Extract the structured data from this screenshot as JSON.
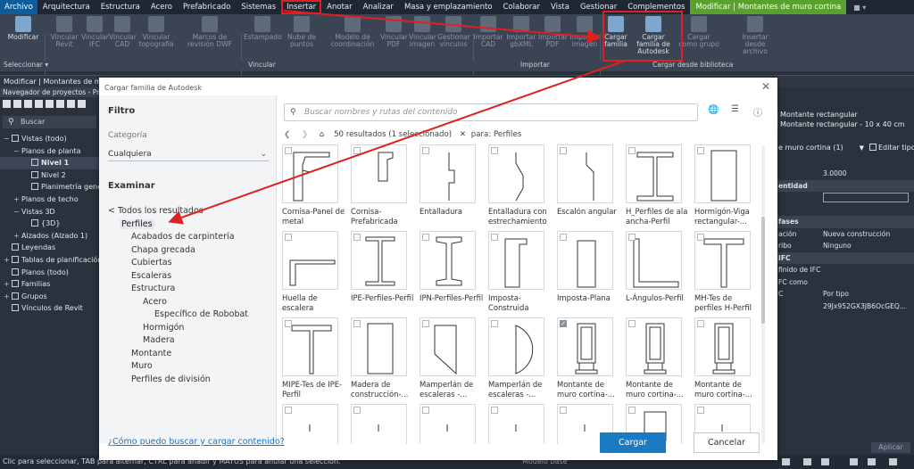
{
  "menu": [
    "Archivo",
    "Arquitectura",
    "Estructura",
    "Acero",
    "Prefabricado",
    "Sistemas",
    "Insertar",
    "Anotar",
    "Analizar",
    "Masa y emplazamiento",
    "Colaborar",
    "Vista",
    "Gestionar",
    "Complementos",
    "Modificar | Montantes de muro cortina"
  ],
  "ribbon": {
    "buttons": [
      "Modificar",
      "Vincular Revit",
      "Vincular IFC",
      "Vincular CAD",
      "Vincular topografía",
      "Marcos de revisión DWF",
      "Estampado",
      "Nube de puntos",
      "Modelo de coordinación",
      "Vincular PDF",
      "Vincular imagen",
      "Gestionar vínculos",
      "Importar CAD",
      "Importar gbXML",
      "Importar PDF",
      "Importar imagen",
      "Cargar familia",
      "Cargar familia de Autodesk",
      "Cargar como grupo",
      "Insertar desde archivo"
    ],
    "panels": [
      "Seleccionar",
      "Vincular",
      "Importar",
      "Cargar desde biblioteca"
    ]
  },
  "context_bar": "Modificar | Montantes de muro",
  "browser": {
    "title": "Navegador de proyectos - Proy",
    "search_placeholder": "Buscar",
    "tree": [
      {
        "t": "−",
        "label": "Vistas (todo)",
        "lvl": 0
      },
      {
        "t": "−",
        "label": "Planos de planta",
        "lvl": 1
      },
      {
        "t": "",
        "label": "Nivel 1",
        "lvl": 2,
        "sel": true
      },
      {
        "t": "",
        "label": "Nivel 2",
        "lvl": 2
      },
      {
        "t": "",
        "label": "Planimetría gener",
        "lvl": 2
      },
      {
        "t": "+",
        "label": "Planos de techo",
        "lvl": 1
      },
      {
        "t": "−",
        "label": "Vistas 3D",
        "lvl": 1
      },
      {
        "t": "",
        "label": "{3D}",
        "lvl": 2
      },
      {
        "t": "+",
        "label": "Alzados (Alzado 1)",
        "lvl": 1
      },
      {
        "t": "",
        "label": "Leyendas",
        "lvl": 0
      },
      {
        "t": "+",
        "label": "Tablas de planificación/c",
        "lvl": 0
      },
      {
        "t": "",
        "label": "Planos (todo)",
        "lvl": 0
      },
      {
        "t": "+",
        "label": "Familias",
        "lvl": 0
      },
      {
        "t": "+",
        "label": "Grupos",
        "lvl": 0
      },
      {
        "t": "",
        "label": "Vínculos de Revit",
        "lvl": 0
      }
    ]
  },
  "properties": {
    "type_name": "Montante rectangular",
    "type_sub": "Montante rectangular - 10 x 40 cm",
    "selector": "e muro cortina (1)",
    "edit_type": "Editar tipo",
    "rows": [
      {
        "k": "",
        "v": "3.0000",
        "hd": false
      },
      {
        "k": "entidad",
        "v": "",
        "hd": true
      },
      {
        "k": "",
        "v": "",
        "hd": false
      },
      {
        "k": "",
        "v": "",
        "hd": false
      },
      {
        "k": "fases",
        "v": "",
        "hd": true
      },
      {
        "k": "ación",
        "v": "Nueva construcción",
        "hd": false
      },
      {
        "k": "ribo",
        "v": "Ninguno",
        "hd": false
      },
      {
        "k": "IFC",
        "v": "",
        "hd": true
      },
      {
        "k": "finido de IFC",
        "v": "",
        "hd": false
      },
      {
        "k": "FC como",
        "v": "",
        "hd": false
      },
      {
        "k": "C",
        "v": "Por tipo",
        "hd": false
      },
      {
        "k": "",
        "v": "29Jx952GX3JB6OcGEQ...",
        "hd": false
      }
    ],
    "apply": "Aplicar"
  },
  "statusbar": {
    "text": "Clic para seleccionar, TAB para alternar, CTRL para añadir y MAYÚS para anular una selección.",
    "model": "Modelo base"
  },
  "dialog": {
    "title": "Cargar familia de Autodesk",
    "filter_heading": "Filtro",
    "category_label": "Categoría",
    "category_value": "Cualquiera",
    "browse_heading": "Examinar",
    "nav": [
      {
        "label": "< Todos los resultados",
        "lvl": 0
      },
      {
        "label": "Perfiles",
        "lvl": 1
      },
      {
        "label": "Acabados de carpintería",
        "lvl": 2
      },
      {
        "label": "Chapa grecada",
        "lvl": 2
      },
      {
        "label": "Cubiertas",
        "lvl": 2
      },
      {
        "label": "Escaleras",
        "lvl": 2
      },
      {
        "label": "Estructura",
        "lvl": 2
      },
      {
        "label": "Acero",
        "lvl": 3
      },
      {
        "label": "Específico de Robobat",
        "lvl": 4
      },
      {
        "label": "Hormigón",
        "lvl": 3
      },
      {
        "label": "Madera",
        "lvl": 3
      },
      {
        "label": "Montante",
        "lvl": 2
      },
      {
        "label": "Muro",
        "lvl": 2
      },
      {
        "label": "Perfiles de división",
        "lvl": 2
      }
    ],
    "search_placeholder": "Buscar nombres y rutas del contenido",
    "results": "50 resultados (1 seleccionado)",
    "results_for": "para: Perfiles",
    "help_link": "¿Cómo puedo buscar y cargar contenido?",
    "load_button": "Cargar",
    "cancel_button": "Cancelar",
    "tiles": [
      {
        "label": "Cornisa-Panel de metal",
        "shape": "cornice1",
        "checked": false
      },
      {
        "label": "Cornisa-Prefabricada",
        "shape": "cornice2",
        "checked": false
      },
      {
        "label": "Entalladura",
        "shape": "notch",
        "checked": false
      },
      {
        "label": "Entalladura con estrechamiento",
        "shape": "notch2",
        "checked": false
      },
      {
        "label": "Escalón angular",
        "shape": "step",
        "checked": false
      },
      {
        "label": "H_Perfiles de ala ancha-Perfil",
        "shape": "hbeam",
        "checked": false
      },
      {
        "label": "Hormigón-Viga rectangular-...",
        "shape": "rect",
        "checked": false
      },
      {
        "label": "Huella de escalera",
        "shape": "tread",
        "checked": false
      },
      {
        "label": "IPE-Perfiles-Perfil",
        "shape": "ibeam",
        "checked": false
      },
      {
        "label": "IPN-Perfiles-Perfil",
        "shape": "ibeam2",
        "checked": false
      },
      {
        "label": "Imposta-Construida",
        "shape": "imposta",
        "checked": false
      },
      {
        "label": "Imposta-Plana",
        "shape": "imposta2",
        "checked": false
      },
      {
        "label": "L-Ángulos-Perfil",
        "shape": "angle",
        "checked": false
      },
      {
        "label": "MH-Tes de perfiles H-Perfil",
        "shape": "tee",
        "checked": false
      },
      {
        "label": "MIPE-Tes de IPE-Perfil",
        "shape": "tee2",
        "checked": false
      },
      {
        "label": "Madera de construcción-...",
        "shape": "wood",
        "checked": false
      },
      {
        "label": "Mamperlán de escaleras -...",
        "shape": "nosing",
        "checked": false
      },
      {
        "label": "Mamperlán de escaleras -...",
        "shape": "nosing2",
        "checked": false
      },
      {
        "label": "Montante de muro cortina-...",
        "shape": "mullion",
        "checked": true
      },
      {
        "label": "Montante de muro cortina-...",
        "shape": "mullion",
        "checked": false
      },
      {
        "label": "Montante de muro cortina-...",
        "shape": "mullion",
        "checked": false
      },
      {
        "label": "",
        "shape": "partial",
        "checked": false
      },
      {
        "label": "",
        "shape": "partial",
        "checked": false
      },
      {
        "label": "",
        "shape": "partial",
        "checked": false
      },
      {
        "label": "",
        "shape": "partial",
        "checked": false
      },
      {
        "label": "",
        "shape": "partial",
        "checked": false
      },
      {
        "label": "",
        "shape": "partialsq",
        "checked": false
      },
      {
        "label": "",
        "shape": "partial",
        "checked": false
      }
    ]
  },
  "colors": {
    "accent": "#1a7bc4",
    "annotation": "#e02020",
    "context_tab": "#5aa02c"
  }
}
